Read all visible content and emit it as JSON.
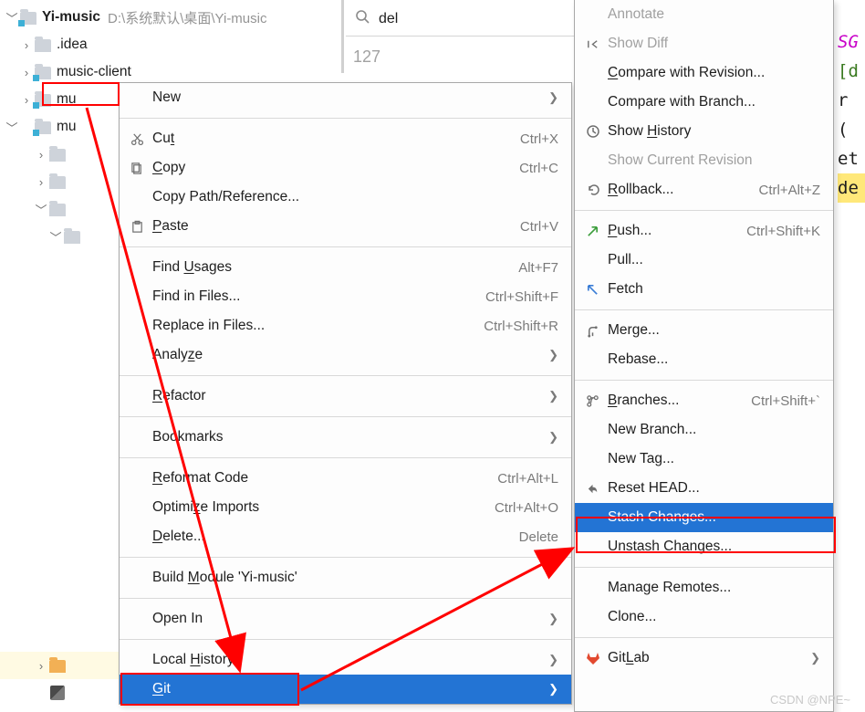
{
  "tree": {
    "root": {
      "name": "Yi-music",
      "path": "D:\\系统默认\\桌面\\Yi-music"
    },
    "items": [
      {
        "name": ".idea"
      },
      {
        "name": "music-client"
      },
      {
        "name": "mu"
      },
      {
        "name": "mu"
      }
    ]
  },
  "search": {
    "value": "del",
    "line": "127"
  },
  "right_code": [
    "SG",
    "",
    "",
    "",
    "",
    "",
    "",
    "",
    "",
    "",
    "",
    "",
    "",
    "[d",
    "r (",
    "et",
    "de"
  ],
  "menu1": [
    {
      "label": "New",
      "submenu": true,
      "icon": ""
    },
    {
      "sep": true
    },
    {
      "label": "Cut",
      "u": "t",
      "shortcut": "Ctrl+X",
      "icon": "cut"
    },
    {
      "label": "Copy",
      "u": "C",
      "shortcut": "Ctrl+C",
      "icon": "copy"
    },
    {
      "label": "Copy Path/Reference...",
      "icon": ""
    },
    {
      "label": "Paste",
      "u": "P",
      "shortcut": "Ctrl+V",
      "icon": "paste"
    },
    {
      "sep": true
    },
    {
      "label": "Find Usages",
      "u": "U",
      "shortcut": "Alt+F7"
    },
    {
      "label": "Find in Files...",
      "shortcut": "Ctrl+Shift+F"
    },
    {
      "label": "Replace in Files...",
      "shortcut": "Ctrl+Shift+R"
    },
    {
      "label": "Analyze",
      "u": "z",
      "submenu": true
    },
    {
      "sep": true
    },
    {
      "label": "Refactor",
      "u": "R",
      "submenu": true
    },
    {
      "sep": true
    },
    {
      "label": "Bookmarks",
      "submenu": true
    },
    {
      "sep": true
    },
    {
      "label": "Reformat Code",
      "u": "R",
      "shortcut": "Ctrl+Alt+L"
    },
    {
      "label": "Optimize Imports",
      "u": "z",
      "shortcut": "Ctrl+Alt+O"
    },
    {
      "label": "Delete...",
      "u": "D",
      "shortcut": "Delete"
    },
    {
      "sep": true
    },
    {
      "label": "Build Module 'Yi-music'",
      "u": "M"
    },
    {
      "sep": true
    },
    {
      "label": "Open In",
      "submenu": true
    },
    {
      "sep": true
    },
    {
      "label": "Local History",
      "u": "H",
      "submenu": true
    },
    {
      "label": "Git",
      "u": "G",
      "submenu": true,
      "selected": true
    }
  ],
  "menu2": [
    {
      "label": "Annotate",
      "disabled": true
    },
    {
      "label": "Show Diff",
      "disabled": true,
      "icon": "diff"
    },
    {
      "label": "Compare with Revision...",
      "u": "C"
    },
    {
      "label": "Compare with Branch..."
    },
    {
      "label": "Show History",
      "u": "H",
      "icon": "clock"
    },
    {
      "label": "Show Current Revision",
      "disabled": true
    },
    {
      "label": "Rollback...",
      "u": "R",
      "shortcut": "Ctrl+Alt+Z",
      "icon": "rollback"
    },
    {
      "sep": true
    },
    {
      "label": "Push...",
      "u": "P",
      "shortcut": "Ctrl+Shift+K",
      "icon": "push"
    },
    {
      "label": "Pull...",
      "icon": ""
    },
    {
      "label": "Fetch",
      "icon": "fetch"
    },
    {
      "sep": true
    },
    {
      "label": "Merge...",
      "icon": "merge"
    },
    {
      "label": "Rebase...",
      "icon": ""
    },
    {
      "sep": true
    },
    {
      "label": "Branches...",
      "u": "B",
      "shortcut": "Ctrl+Shift+`",
      "icon": "branch"
    },
    {
      "label": "New Branch...",
      "icon": ""
    },
    {
      "label": "New Tag...",
      "icon": ""
    },
    {
      "label": "Reset HEAD...",
      "icon": "reset"
    },
    {
      "label": "Stash Changes...",
      "selected": true
    },
    {
      "label": "Unstash Changes..."
    },
    {
      "sep": true
    },
    {
      "label": "Manage Remotes..."
    },
    {
      "label": "Clone..."
    },
    {
      "sep": true
    },
    {
      "label": "GitLab",
      "u": "L",
      "icon": "gitlab",
      "submenu": true
    }
  ],
  "watermark": "CSDN @NPE~"
}
